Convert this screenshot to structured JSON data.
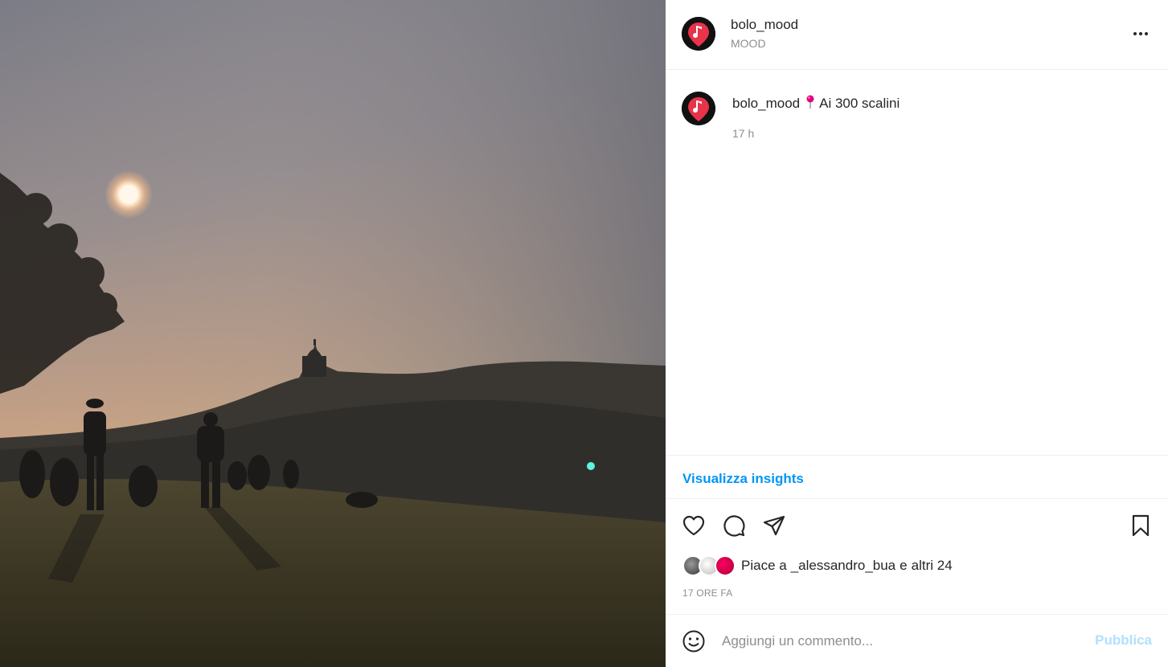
{
  "post": {
    "photo_description": "",
    "header": {
      "username": "bolo_mood",
      "subtitle": "MOOD"
    },
    "caption": {
      "username": "bolo_mood",
      "location_text": "Ai 300 scalini",
      "time": "17 h"
    },
    "insights_label": "Visualizza insights",
    "likes": {
      "prefix": "Piace a",
      "user": "_alessandro_bua",
      "conjunction": "e",
      "others": "altri 24"
    },
    "timestamp": "17 ORE FA",
    "comment": {
      "placeholder": "Aggiungi un commento...",
      "value": "",
      "publish_label": "Pubblica"
    },
    "icons": {
      "avatar": "map-pin-music-note-icon",
      "more": "more-options-icon",
      "like": "heart-icon",
      "comment": "comment-bubble-icon",
      "share": "paper-plane-icon",
      "save": "bookmark-icon",
      "emoji": "smiley-icon",
      "caption_pin": "round-pushpin-icon"
    },
    "colors": {
      "link": "#0095f6",
      "publish_disabled": "#b2dffc",
      "muted": "#8e8e8e",
      "avatar_pin": "#e8334a"
    }
  }
}
